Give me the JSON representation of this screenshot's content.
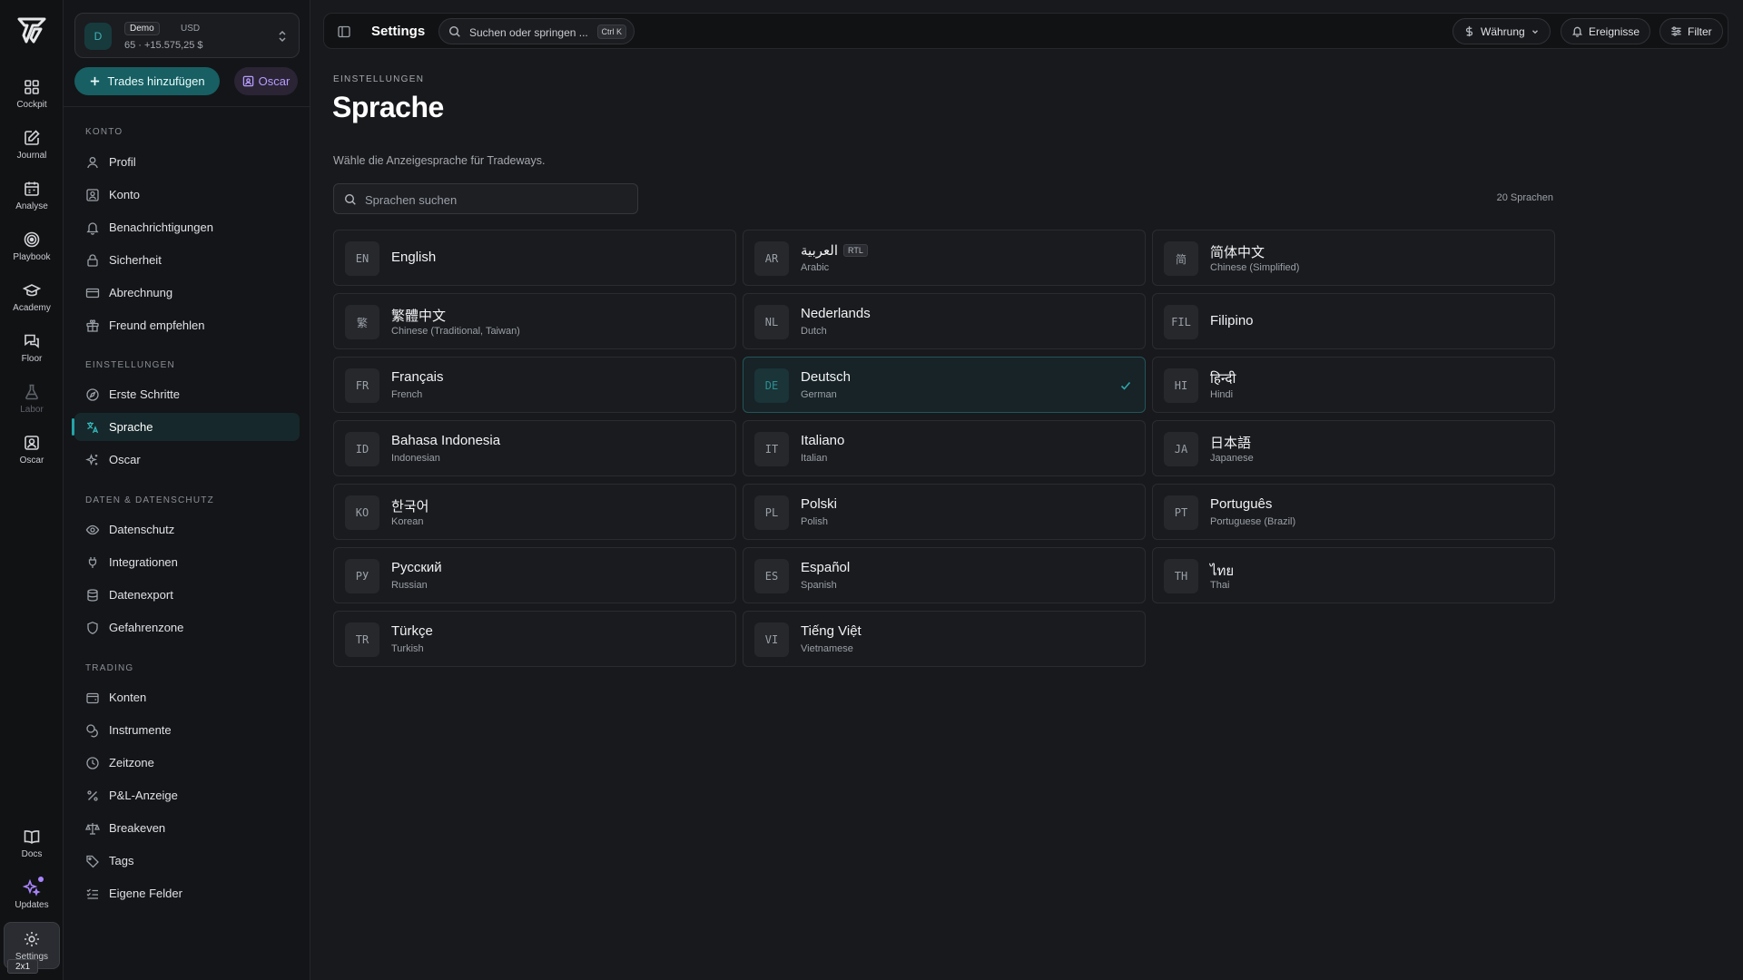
{
  "rail": {
    "items": [
      {
        "label": "Cockpit"
      },
      {
        "label": "Journal"
      },
      {
        "label": "Analyse"
      },
      {
        "label": "Playbook"
      },
      {
        "label": "Academy"
      },
      {
        "label": "Floor"
      },
      {
        "label": "Labor"
      },
      {
        "label": "Oscar"
      }
    ],
    "bottom": [
      {
        "label": "Docs"
      },
      {
        "label": "Updates"
      },
      {
        "label": "Settings"
      }
    ],
    "zoom_badge": "2x1"
  },
  "account": {
    "avatar": "D",
    "badge": "Demo",
    "currency": "USD",
    "balance": "65 · +15.575,25 $"
  },
  "actions": {
    "add_trades": "Trades hinzufügen",
    "oscar": "Oscar"
  },
  "sidebar": {
    "sections": [
      {
        "title": "KONTO",
        "items": [
          "Profil",
          "Konto",
          "Benachrichtigungen",
          "Sicherheit",
          "Abrechnung",
          "Freund empfehlen"
        ]
      },
      {
        "title": "EINSTELLUNGEN",
        "items": [
          "Erste Schritte",
          "Sprache",
          "Oscar"
        ]
      },
      {
        "title": "DATEN & DATENSCHUTZ",
        "items": [
          "Datenschutz",
          "Integrationen",
          "Datenexport",
          "Gefahrenzone"
        ]
      },
      {
        "title": "TRADING",
        "items": [
          "Konten",
          "Instrumente",
          "Zeitzone",
          "P&L-Anzeige",
          "Breakeven",
          "Tags",
          "Eigene Felder"
        ]
      }
    ],
    "active_item": "Sprache"
  },
  "topbar": {
    "title": "Settings",
    "search_placeholder": "Suchen oder springen ...",
    "search_shortcut": "Ctrl K",
    "currency_button": "Währung",
    "events_button": "Ereignisse",
    "filter_button": "Filter"
  },
  "main": {
    "eyebrow": "EINSTELLUNGEN",
    "title": "Sprache",
    "description": "Wähle die Anzeigesprache für Tradeways.",
    "search_placeholder": "Sprachen suchen",
    "search_value": "",
    "count": "20 Sprachen",
    "languages": [
      {
        "code": "EN",
        "native": "English",
        "english": ""
      },
      {
        "code": "AR",
        "native": "العربية",
        "english": "Arabic",
        "badge": "RTL"
      },
      {
        "code": "简",
        "native": "简体中文",
        "english": "Chinese (Simplified)"
      },
      {
        "code": "繁",
        "native": "繁體中文",
        "english": "Chinese (Traditional, Taiwan)"
      },
      {
        "code": "NL",
        "native": "Nederlands",
        "english": "Dutch"
      },
      {
        "code": "FIL",
        "native": "Filipino",
        "english": ""
      },
      {
        "code": "FR",
        "native": "Français",
        "english": "French"
      },
      {
        "code": "DE",
        "native": "Deutsch",
        "english": "German",
        "selected": true
      },
      {
        "code": "HI",
        "native": "हिन्दी",
        "english": "Hindi"
      },
      {
        "code": "ID",
        "native": "Bahasa Indonesia",
        "english": "Indonesian"
      },
      {
        "code": "IT",
        "native": "Italiano",
        "english": "Italian"
      },
      {
        "code": "JA",
        "native": "日本語",
        "english": "Japanese"
      },
      {
        "code": "KO",
        "native": "한국어",
        "english": "Korean"
      },
      {
        "code": "PL",
        "native": "Polski",
        "english": "Polish"
      },
      {
        "code": "PT",
        "native": "Português",
        "english": "Portuguese (Brazil)"
      },
      {
        "code": "РУ",
        "native": "Русский",
        "english": "Russian"
      },
      {
        "code": "ES",
        "native": "Español",
        "english": "Spanish"
      },
      {
        "code": "TH",
        "native": "ไทย",
        "english": "Thai"
      },
      {
        "code": "TR",
        "native": "Türkçe",
        "english": "Turkish"
      },
      {
        "code": "VI",
        "native": "Tiếng Việt",
        "english": "Vietnamese"
      }
    ]
  },
  "colors": {
    "accent": "#24a3a8",
    "oscar_purple": "#b79cff",
    "background": "#18191c"
  }
}
